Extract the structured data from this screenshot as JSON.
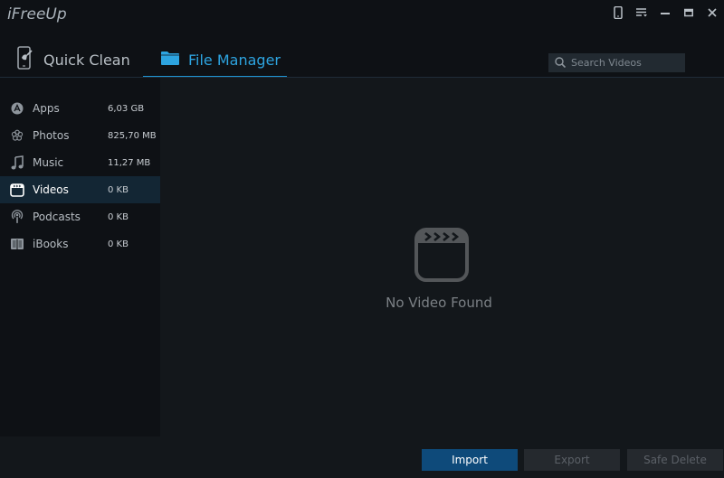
{
  "app": {
    "title": "iFreeUp"
  },
  "window_controls": [
    {
      "name": "device-icon"
    },
    {
      "name": "menu-icon"
    },
    {
      "name": "minimize-icon"
    },
    {
      "name": "maximize-icon"
    },
    {
      "name": "close-icon"
    }
  ],
  "tabs": [
    {
      "label": "Quick Clean",
      "icon": "phone-clean-icon",
      "active": false
    },
    {
      "label": "File Manager",
      "icon": "folder-icon",
      "active": true
    }
  ],
  "search": {
    "placeholder": "Search Videos",
    "value": ""
  },
  "sidebar": {
    "items": [
      {
        "label": "Apps",
        "size": "6,03 GB",
        "icon": "app-store-icon",
        "active": false
      },
      {
        "label": "Photos",
        "size": "825,70 MB",
        "icon": "photos-flower-icon",
        "active": false
      },
      {
        "label": "Music",
        "size": "11,27 MB",
        "icon": "music-note-icon",
        "active": false
      },
      {
        "label": "Videos",
        "size": "0 KB",
        "icon": "video-clapper-icon",
        "active": true
      },
      {
        "label": "Podcasts",
        "size": "0 KB",
        "icon": "podcast-icon",
        "active": false
      },
      {
        "label": "iBooks",
        "size": "0 KB",
        "icon": "book-icon",
        "active": false
      }
    ]
  },
  "main": {
    "empty_icon": "video-clapper-icon",
    "empty_message": "No Video Found"
  },
  "footer": {
    "import_label": "Import",
    "export_label": "Export",
    "delete_label": "Safe Delete"
  },
  "colors": {
    "accent": "#1f94d2",
    "active_tab_text": "#2da4e0",
    "import_button": "#0e4a7a",
    "active_sidebar": "#132634"
  }
}
